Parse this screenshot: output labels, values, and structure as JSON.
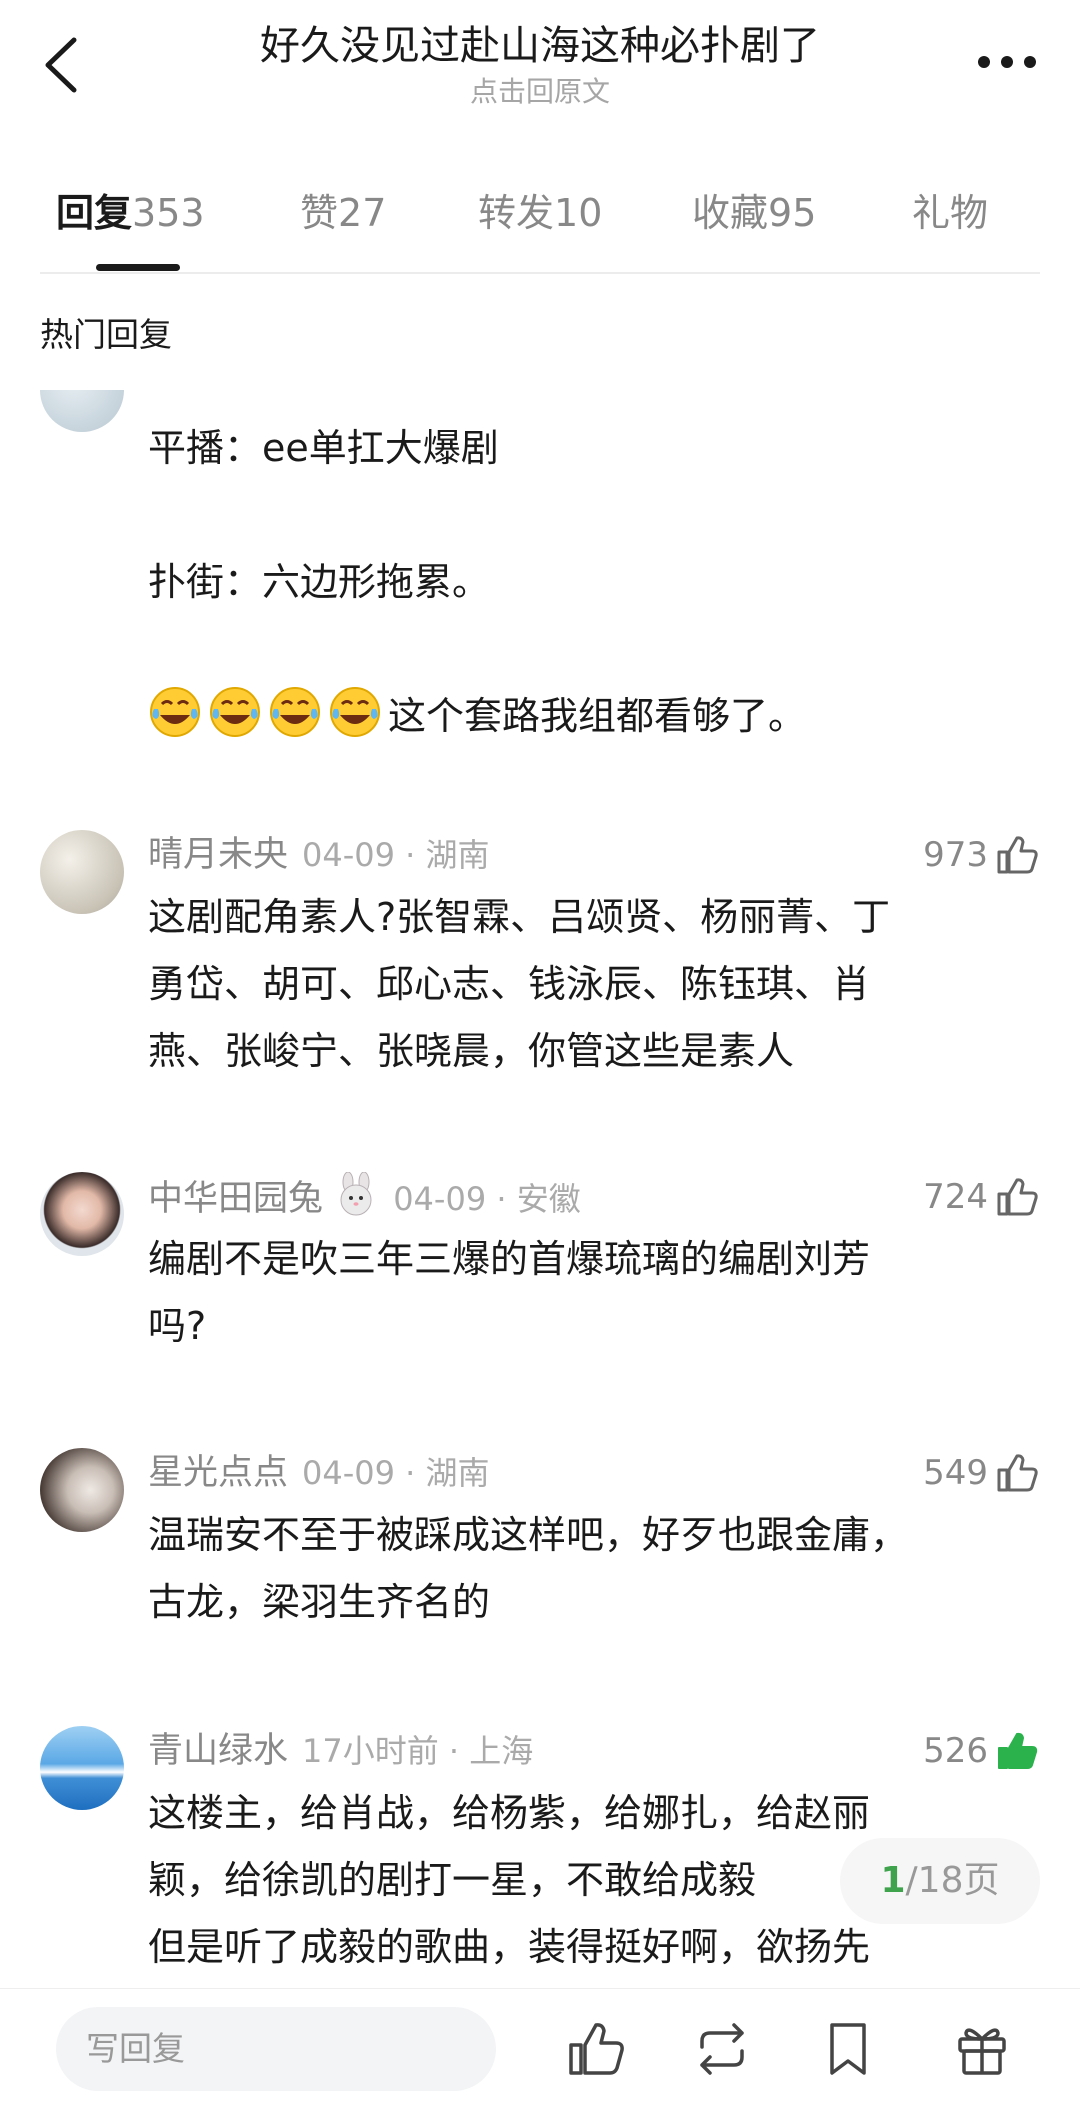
{
  "header": {
    "title": "好久没见过赴山海这种必扑剧了",
    "subtitle": "点击回原文",
    "back_icon": "chevron-left-icon",
    "more_icon": "more-dots-icon"
  },
  "tabs": [
    {
      "label": "回复",
      "count": "353",
      "active": true
    },
    {
      "label": "赞",
      "count": "27",
      "active": false
    },
    {
      "label": "转发",
      "count": "10",
      "active": false
    },
    {
      "label": "收藏",
      "count": "95",
      "active": false
    },
    {
      "label": "礼物",
      "count": "",
      "active": false
    }
  ],
  "section_title": "热门回复",
  "partial_comment": {
    "line1": "平播：ee单扛大爆剧",
    "line2": "扑街：六边形拖累。",
    "line3": "这个套路我组都看够了。",
    "emoji_icon": "laughing-tears-emoji"
  },
  "comments": [
    {
      "name": "晴月未央",
      "time": "04-09 · 湖南",
      "likes": "973",
      "liked": false,
      "lines": [
        "这剧配角素人?张智霖、吕颂贤、杨丽菁、丁",
        "勇岱、胡可、邱心志、钱泳辰、陈钰琪、肖",
        "燕、张峻宁、张晓晨，你管这些是素人"
      ]
    },
    {
      "name": "中华田园兔",
      "name_emoji": "rabbit-face-emoji",
      "time": "04-09 · 安徽",
      "likes": "724",
      "liked": false,
      "lines": [
        "编剧不是吹三年三爆的首爆琉璃的编剧刘芳",
        "吗?"
      ]
    },
    {
      "name": "星光点点",
      "time": "04-09 · 湖南",
      "likes": "549",
      "liked": false,
      "lines": [
        "温瑞安不至于被踩成这样吧，好歹也跟金庸，",
        "古龙，梁羽生齐名的"
      ]
    },
    {
      "name": "青山绿水",
      "time": "17小时前 · 上海",
      "likes": "526",
      "liked": true,
      "lines": [
        "这楼主，给肖战，给杨紫，给娜扎，给赵丽",
        "颖，给徐凯的剧打一星，不敢给成毅",
        "但是听了成毅的歌曲，装得挺好啊，欲扬先"
      ]
    }
  ],
  "pager": {
    "current": "1",
    "total": "/18页"
  },
  "bottom_bar": {
    "reply_placeholder": "写回复",
    "icons": [
      "thumbs-up-icon",
      "repost-icon",
      "bookmark-icon",
      "gift-icon"
    ]
  },
  "colors": {
    "liked_green": "#2bb24c",
    "pager_current": "#3fa34d",
    "muted_text": "#888888"
  }
}
